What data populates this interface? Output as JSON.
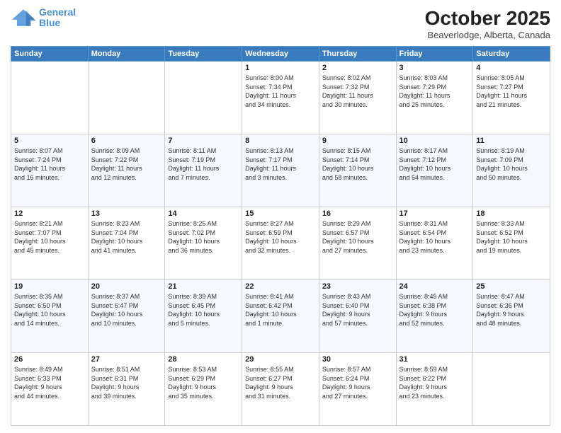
{
  "header": {
    "logo_line1": "General",
    "logo_line2": "Blue",
    "month": "October 2025",
    "location": "Beaverlodge, Alberta, Canada"
  },
  "weekdays": [
    "Sunday",
    "Monday",
    "Tuesday",
    "Wednesday",
    "Thursday",
    "Friday",
    "Saturday"
  ],
  "weeks": [
    [
      {
        "day": "",
        "info": ""
      },
      {
        "day": "",
        "info": ""
      },
      {
        "day": "",
        "info": ""
      },
      {
        "day": "1",
        "info": "Sunrise: 8:00 AM\nSunset: 7:34 PM\nDaylight: 11 hours\nand 34 minutes."
      },
      {
        "day": "2",
        "info": "Sunrise: 8:02 AM\nSunset: 7:32 PM\nDaylight: 11 hours\nand 30 minutes."
      },
      {
        "day": "3",
        "info": "Sunrise: 8:03 AM\nSunset: 7:29 PM\nDaylight: 11 hours\nand 25 minutes."
      },
      {
        "day": "4",
        "info": "Sunrise: 8:05 AM\nSunset: 7:27 PM\nDaylight: 11 hours\nand 21 minutes."
      }
    ],
    [
      {
        "day": "5",
        "info": "Sunrise: 8:07 AM\nSunset: 7:24 PM\nDaylight: 11 hours\nand 16 minutes."
      },
      {
        "day": "6",
        "info": "Sunrise: 8:09 AM\nSunset: 7:22 PM\nDaylight: 11 hours\nand 12 minutes."
      },
      {
        "day": "7",
        "info": "Sunrise: 8:11 AM\nSunset: 7:19 PM\nDaylight: 11 hours\nand 7 minutes."
      },
      {
        "day": "8",
        "info": "Sunrise: 8:13 AM\nSunset: 7:17 PM\nDaylight: 11 hours\nand 3 minutes."
      },
      {
        "day": "9",
        "info": "Sunrise: 8:15 AM\nSunset: 7:14 PM\nDaylight: 10 hours\nand 58 minutes."
      },
      {
        "day": "10",
        "info": "Sunrise: 8:17 AM\nSunset: 7:12 PM\nDaylight: 10 hours\nand 54 minutes."
      },
      {
        "day": "11",
        "info": "Sunrise: 8:19 AM\nSunset: 7:09 PM\nDaylight: 10 hours\nand 50 minutes."
      }
    ],
    [
      {
        "day": "12",
        "info": "Sunrise: 8:21 AM\nSunset: 7:07 PM\nDaylight: 10 hours\nand 45 minutes."
      },
      {
        "day": "13",
        "info": "Sunrise: 8:23 AM\nSunset: 7:04 PM\nDaylight: 10 hours\nand 41 minutes."
      },
      {
        "day": "14",
        "info": "Sunrise: 8:25 AM\nSunset: 7:02 PM\nDaylight: 10 hours\nand 36 minutes."
      },
      {
        "day": "15",
        "info": "Sunrise: 8:27 AM\nSunset: 6:59 PM\nDaylight: 10 hours\nand 32 minutes."
      },
      {
        "day": "16",
        "info": "Sunrise: 8:29 AM\nSunset: 6:57 PM\nDaylight: 10 hours\nand 27 minutes."
      },
      {
        "day": "17",
        "info": "Sunrise: 8:31 AM\nSunset: 6:54 PM\nDaylight: 10 hours\nand 23 minutes."
      },
      {
        "day": "18",
        "info": "Sunrise: 8:33 AM\nSunset: 6:52 PM\nDaylight: 10 hours\nand 19 minutes."
      }
    ],
    [
      {
        "day": "19",
        "info": "Sunrise: 8:35 AM\nSunset: 6:50 PM\nDaylight: 10 hours\nand 14 minutes."
      },
      {
        "day": "20",
        "info": "Sunrise: 8:37 AM\nSunset: 6:47 PM\nDaylight: 10 hours\nand 10 minutes."
      },
      {
        "day": "21",
        "info": "Sunrise: 8:39 AM\nSunset: 6:45 PM\nDaylight: 10 hours\nand 5 minutes."
      },
      {
        "day": "22",
        "info": "Sunrise: 8:41 AM\nSunset: 6:42 PM\nDaylight: 10 hours\nand 1 minute."
      },
      {
        "day": "23",
        "info": "Sunrise: 8:43 AM\nSunset: 6:40 PM\nDaylight: 9 hours\nand 57 minutes."
      },
      {
        "day": "24",
        "info": "Sunrise: 8:45 AM\nSunset: 6:38 PM\nDaylight: 9 hours\nand 52 minutes."
      },
      {
        "day": "25",
        "info": "Sunrise: 8:47 AM\nSunset: 6:36 PM\nDaylight: 9 hours\nand 48 minutes."
      }
    ],
    [
      {
        "day": "26",
        "info": "Sunrise: 8:49 AM\nSunset: 6:33 PM\nDaylight: 9 hours\nand 44 minutes."
      },
      {
        "day": "27",
        "info": "Sunrise: 8:51 AM\nSunset: 6:31 PM\nDaylight: 9 hours\nand 39 minutes."
      },
      {
        "day": "28",
        "info": "Sunrise: 8:53 AM\nSunset: 6:29 PM\nDaylight: 9 hours\nand 35 minutes."
      },
      {
        "day": "29",
        "info": "Sunrise: 8:55 AM\nSunset: 6:27 PM\nDaylight: 9 hours\nand 31 minutes."
      },
      {
        "day": "30",
        "info": "Sunrise: 8:57 AM\nSunset: 6:24 PM\nDaylight: 9 hours\nand 27 minutes."
      },
      {
        "day": "31",
        "info": "Sunrise: 8:59 AM\nSunset: 6:22 PM\nDaylight: 9 hours\nand 23 minutes."
      },
      {
        "day": "",
        "info": ""
      }
    ]
  ]
}
